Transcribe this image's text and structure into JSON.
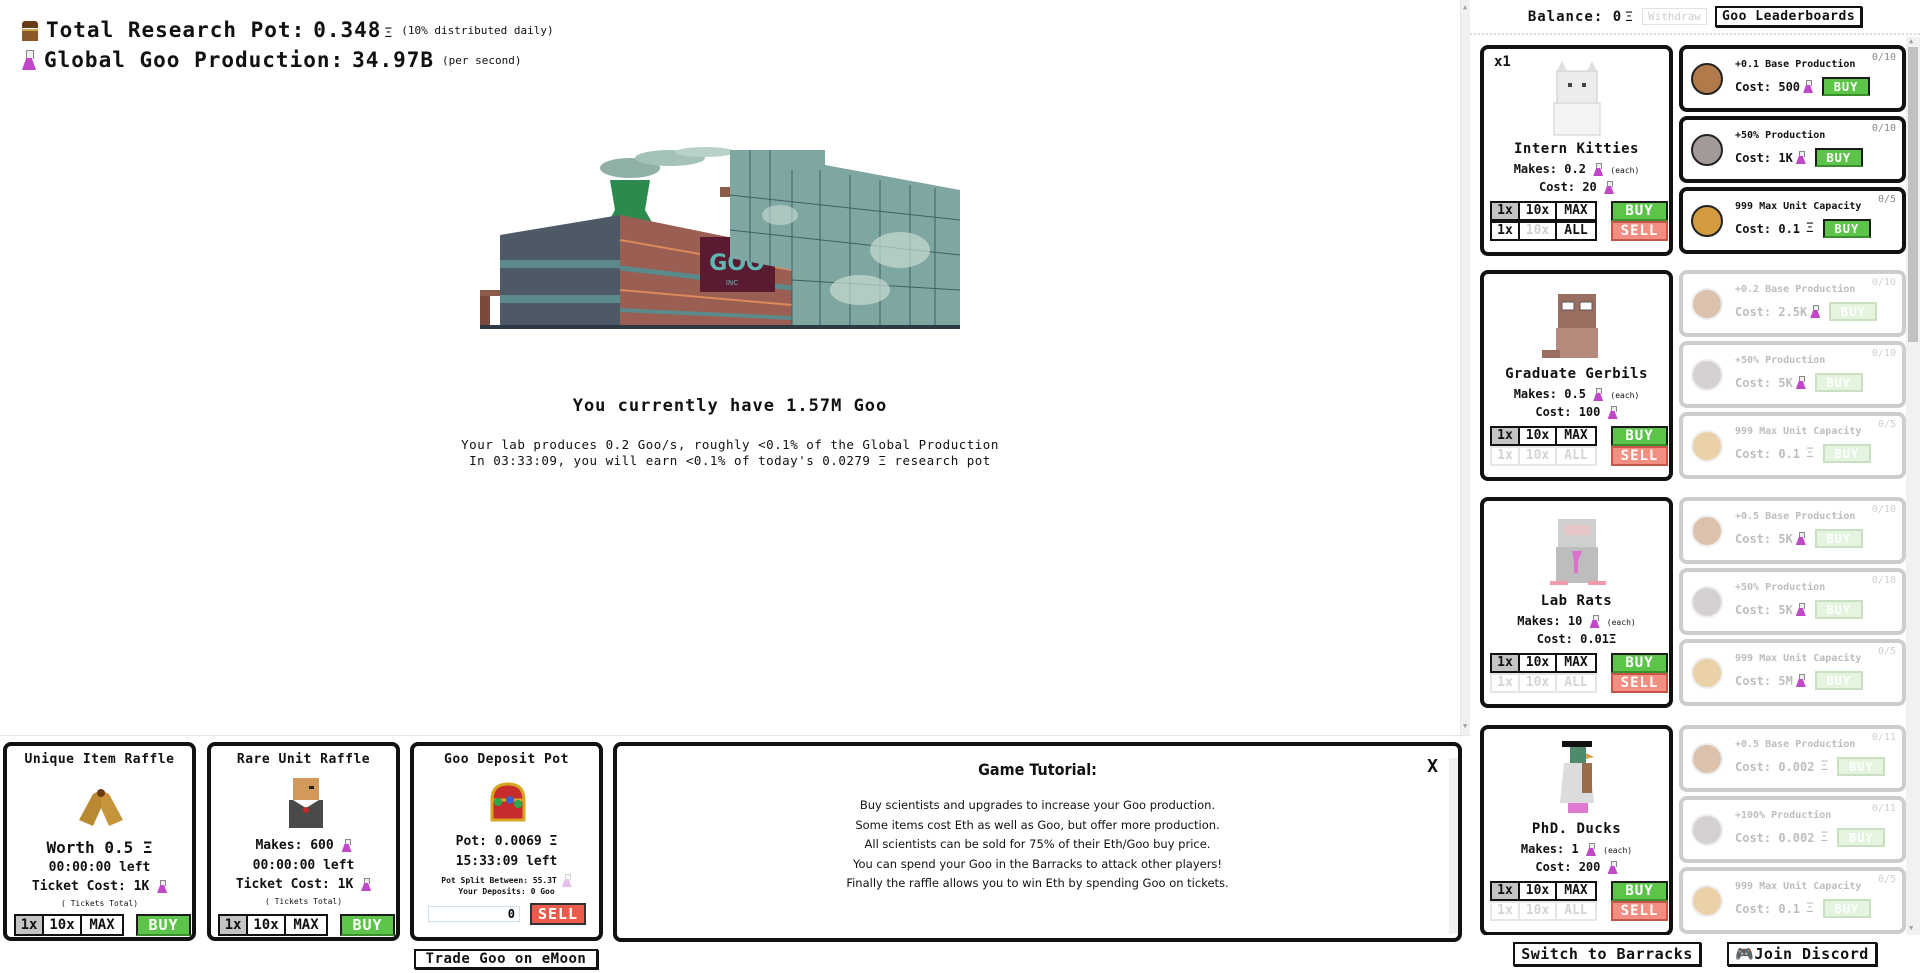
{
  "stats": {
    "research_pot_label": "Total Research Pot:",
    "research_pot_value": "0.348",
    "research_pot_note": "(10% distributed daily)",
    "global_prod_label": "Global Goo Production:",
    "global_prod_value": "34.97B",
    "global_prod_note": "(per second)"
  },
  "eth_symbol": "Ξ",
  "factory": {
    "sign": "GOO",
    "sign_sub": "INC"
  },
  "lab": {
    "goo_have": "You currently have 1.57M Goo",
    "prod_line1": "Your lab produces 0.2 Goo/s, roughly <0.1% of the Global Production",
    "prod_line2": "In 03:33:09, you will earn <0.1% of today's 0.0279 Ξ research pot"
  },
  "raffles": [
    {
      "title": "Unique Item Raffle",
      "line1": "Worth 0.5 Ξ",
      "time_left": "00:00:00 left",
      "ticket_cost": "Ticket Cost: 1K",
      "tickets_total": "( Tickets Total)",
      "qty": [
        "1x",
        "10x",
        "MAX"
      ],
      "buy": "BUY",
      "sprite": "flippers"
    },
    {
      "title": "Rare Unit Raffle",
      "line1": "Makes: 600",
      "time_left": "00:00:00 left",
      "ticket_cost": "Ticket Cost: 1K",
      "tickets_total": "( Tickets Total)",
      "qty": [
        "1x",
        "10x",
        "MAX"
      ],
      "buy": "BUY",
      "sprite": "doge-scientist"
    }
  ],
  "deposit_pot": {
    "title": "Goo Deposit Pot",
    "pot": "Pot: 0.0069 Ξ",
    "time_left": "15:33:09 left",
    "split": "Pot Split Between: 55.3T",
    "your_deposits": "Your Deposits: 0 Goo",
    "input_value": "0",
    "sell": "SELL",
    "trade_link": "Trade Goo on eMoon"
  },
  "tutorial": {
    "title": "Game Tutorial:",
    "close": "X",
    "lines": [
      "Buy scientists and upgrades to increase your Goo production.",
      "Some items cost Eth as well as Goo, but offer more production.",
      "All scientists can be sold for 75% of their Eth/Goo buy price.",
      "You can spend your Goo in the Barracks to attack other players!",
      "Finally the raffle allows you to win Eth by spending Goo on tickets."
    ]
  },
  "right_header": {
    "balance_label": "Balance:",
    "balance_value": "0",
    "withdraw": "Withdraw",
    "leaderboards": "Goo Leaderboards"
  },
  "units": [
    {
      "count": "x1",
      "name": "Intern Kitties",
      "makes": "Makes: 0.2",
      "each": "(each)",
      "cost": "Cost: 20",
      "cost_currency": "goo",
      "buy_qty": [
        "1x",
        "10x",
        "MAX"
      ],
      "sell_qty": [
        "1x",
        "10x",
        "ALL"
      ],
      "buy": "BUY",
      "sell": "SELL",
      "selected": "1x",
      "sell_enabled": true,
      "upgrades": [
        {
          "title": "+0.1 Base Production",
          "cost": "Cost: 500",
          "currency": "goo",
          "level": "0/10",
          "buy": "BUY",
          "enabled": true,
          "coin": "#b27a4a"
        },
        {
          "title": "+50% Production",
          "cost": "Cost: 1K",
          "currency": "goo",
          "level": "0/10",
          "buy": "BUY",
          "enabled": true,
          "coin": "#a39a98"
        },
        {
          "title": "999 Max Unit Capacity",
          "cost": "Cost: 0.1",
          "currency": "eth",
          "level": "0/5",
          "buy": "BUY",
          "enabled": true,
          "coin": "#d39a3f"
        }
      ]
    },
    {
      "count": "",
      "name": "Graduate Gerbils",
      "makes": "Makes: 0.5",
      "each": "(each)",
      "cost": "Cost: 100",
      "cost_currency": "goo",
      "buy_qty": [
        "1x",
        "10x",
        "MAX"
      ],
      "sell_qty": [
        "1x",
        "10x",
        "ALL"
      ],
      "buy": "BUY",
      "sell": "SELL",
      "selected": "1x",
      "sell_enabled": false,
      "upgrades": [
        {
          "title": "+0.2 Base Production",
          "cost": "Cost: 2.5K",
          "currency": "goo",
          "level": "0/10",
          "buy": "BUY",
          "enabled": false,
          "coin": "#b27a4a"
        },
        {
          "title": "+50% Production",
          "cost": "Cost: 5K",
          "currency": "goo",
          "level": "0/10",
          "buy": "BUY",
          "enabled": false,
          "coin": "#a39a98"
        },
        {
          "title": "999 Max Unit Capacity",
          "cost": "Cost: 0.1",
          "currency": "eth",
          "level": "0/5",
          "buy": "BUY",
          "enabled": false,
          "coin": "#d39a3f"
        }
      ]
    },
    {
      "count": "",
      "name": "Lab Rats",
      "makes": "Makes: 10",
      "each": "(each)",
      "cost": "Cost: 0.01Ξ",
      "cost_currency": "none",
      "buy_qty": [
        "1x",
        "10x",
        "MAX"
      ],
      "sell_qty": [
        "1x",
        "10x",
        "ALL"
      ],
      "buy": "BUY",
      "sell": "SELL",
      "selected": "1x",
      "sell_enabled": false,
      "upgrades": [
        {
          "title": "+0.5 Base Production",
          "cost": "Cost: 5K",
          "currency": "goo",
          "level": "0/10",
          "buy": "BUY",
          "enabled": false,
          "coin": "#b27a4a"
        },
        {
          "title": "+50% Production",
          "cost": "Cost: 5K",
          "currency": "goo",
          "level": "0/10",
          "buy": "BUY",
          "enabled": false,
          "coin": "#a39a98"
        },
        {
          "title": "999 Max Unit Capacity",
          "cost": "Cost: 5M",
          "currency": "goo",
          "level": "0/5",
          "buy": "BUY",
          "enabled": false,
          "coin": "#d39a3f"
        }
      ]
    },
    {
      "count": "",
      "name": "PhD. Ducks",
      "makes": "Makes: 1",
      "each": "(each)",
      "cost": "Cost: 200",
      "cost_currency": "goo",
      "buy_qty": [
        "1x",
        "10x",
        "MAX"
      ],
      "sell_qty": [
        "1x",
        "10x",
        "ALL"
      ],
      "buy": "BUY",
      "sell": "SELL",
      "selected": "1x",
      "sell_enabled": false,
      "upgrades": [
        {
          "title": "+0.5 Base Production",
          "cost": "Cost: 0.002",
          "currency": "eth",
          "level": "0/11",
          "buy": "BUY",
          "enabled": false,
          "coin": "#b27a4a"
        },
        {
          "title": "+100% Production",
          "cost": "Cost: 0.002",
          "currency": "eth",
          "level": "0/11",
          "buy": "BUY",
          "enabled": false,
          "coin": "#a39a98"
        },
        {
          "title": "999 Max Unit Capacity",
          "cost": "Cost: 0.1",
          "currency": "eth",
          "level": "0/5",
          "buy": "BUY",
          "enabled": false,
          "coin": "#d39a3f"
        }
      ]
    }
  ],
  "right_footer": {
    "barracks": "Switch to Barracks",
    "discord": "Join Discord"
  }
}
